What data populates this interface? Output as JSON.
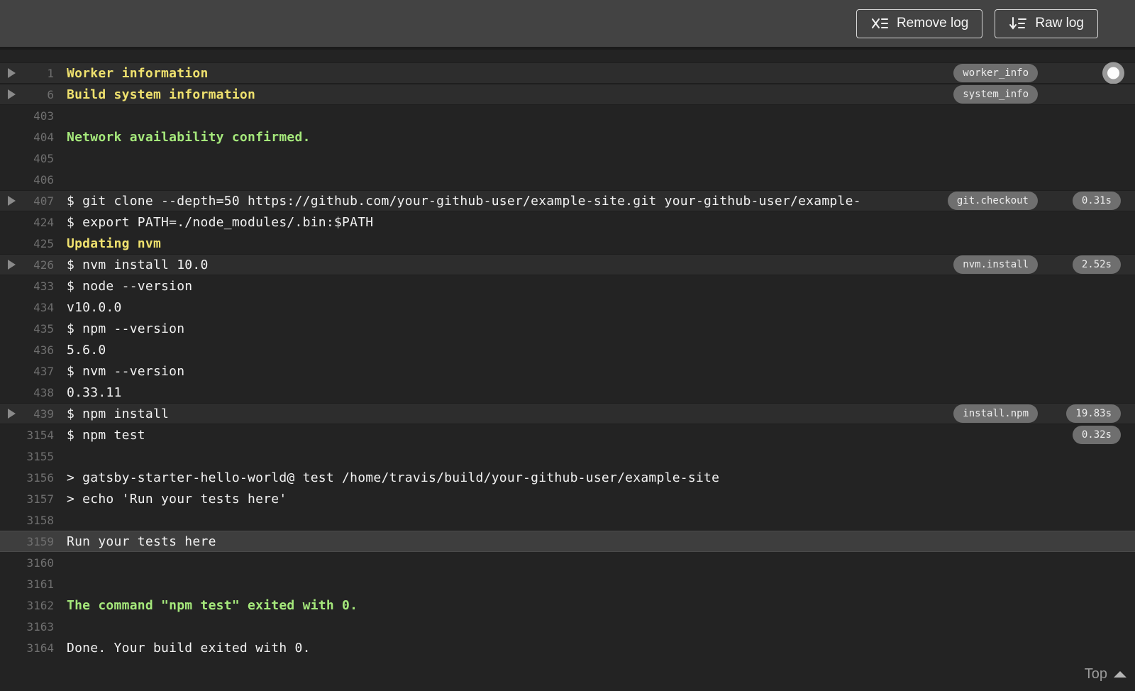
{
  "toolbar": {
    "remove_log_label": "Remove log",
    "raw_log_label": "Raw log"
  },
  "log": {
    "lines": [
      {
        "num": "1",
        "text": "Worker information",
        "style": "yellow",
        "row": "fold",
        "fold": true,
        "tag": "worker_info",
        "follow_circle": true
      },
      {
        "num": "6",
        "text": "Build system information",
        "style": "yellow",
        "row": "fold",
        "fold": true,
        "tag": "system_info"
      },
      {
        "num": "403",
        "text": ""
      },
      {
        "num": "404",
        "text": "Network availability confirmed.",
        "style": "green"
      },
      {
        "num": "405",
        "text": ""
      },
      {
        "num": "406",
        "text": ""
      },
      {
        "num": "407",
        "text": "$ git clone --depth=50 https://github.com/your-github-user/example-site.git your-github-user/example-",
        "row": "fold",
        "fold": true,
        "tag": "git.checkout",
        "duration": "0.31s"
      },
      {
        "num": "424",
        "text": "$ export PATH=./node_modules/.bin:$PATH"
      },
      {
        "num": "425",
        "text": "Updating nvm",
        "style": "yellow"
      },
      {
        "num": "426",
        "text": "$ nvm install 10.0",
        "row": "fold",
        "fold": true,
        "tag": "nvm.install",
        "duration": "2.52s"
      },
      {
        "num": "433",
        "text": "$ node --version"
      },
      {
        "num": "434",
        "text": "v10.0.0"
      },
      {
        "num": "435",
        "text": "$ npm --version"
      },
      {
        "num": "436",
        "text": "5.6.0"
      },
      {
        "num": "437",
        "text": "$ nvm --version"
      },
      {
        "num": "438",
        "text": "0.33.11"
      },
      {
        "num": "439",
        "text": "$ npm install",
        "row": "fold",
        "fold": true,
        "tag": "install.npm",
        "duration": "19.83s"
      },
      {
        "num": "3154",
        "text": "$ npm test",
        "duration": "0.32s"
      },
      {
        "num": "3155",
        "text": ""
      },
      {
        "num": "3156",
        "text": "> gatsby-starter-hello-world@ test /home/travis/build/your-github-user/example-site"
      },
      {
        "num": "3157",
        "text": "> echo 'Run your tests here'"
      },
      {
        "num": "3158",
        "text": ""
      },
      {
        "num": "3159",
        "text": "Run your tests here",
        "row": "highlight"
      },
      {
        "num": "3160",
        "text": ""
      },
      {
        "num": "3161",
        "text": ""
      },
      {
        "num": "3162",
        "text": "The command \"npm test\" exited with 0.",
        "style": "green"
      },
      {
        "num": "3163",
        "text": ""
      },
      {
        "num": "3164",
        "text": "Done. Your build exited with 0."
      }
    ],
    "footer": {
      "top_label": "Top"
    }
  },
  "colors": {
    "toolbar_bg": "#434343",
    "log_bg": "#232323",
    "fold_row_bg": "#2d2d2d",
    "highlight_row_bg": "#3e3e3e",
    "text_plain": "#f1f1f1",
    "text_yellow": "#efe16e",
    "text_green": "#a5e87b",
    "line_number": "#6f6f6f",
    "pill_bg": "#6f6f6f"
  }
}
